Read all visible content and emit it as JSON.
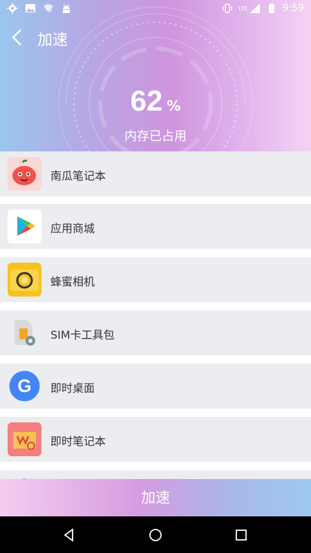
{
  "status_bar": {
    "time": "9:59",
    "lte_label": "LTE",
    "left_icons": [
      "gear-icon",
      "image-icon",
      "wifi-question-icon",
      "android-icon"
    ],
    "right_icons": [
      "vibrate-icon",
      "signal-icon",
      "battery-icon"
    ]
  },
  "header": {
    "title": "加速",
    "percent_value": "62",
    "percent_unit": "%",
    "memory_label": "内存已占用"
  },
  "apps": [
    {
      "name": "南瓜笔记本",
      "icon": "pumpkin-notes-icon"
    },
    {
      "name": "应用商城",
      "icon": "play-store-icon"
    },
    {
      "name": "蜂蜜相机",
      "icon": "honey-camera-icon"
    },
    {
      "name": "SIM卡工具包",
      "icon": "sim-toolkit-icon"
    },
    {
      "name": "即时桌面",
      "icon": "google-icon"
    },
    {
      "name": "即时笔记本",
      "icon": "instant-notes-icon"
    }
  ],
  "action": {
    "accelerate_label": "加速"
  },
  "colors": {
    "header_gradient": [
      "#9bc6ee",
      "#cf95dd",
      "#f5d2f4"
    ],
    "row_background": "#ebedf0",
    "text": "#333333"
  }
}
